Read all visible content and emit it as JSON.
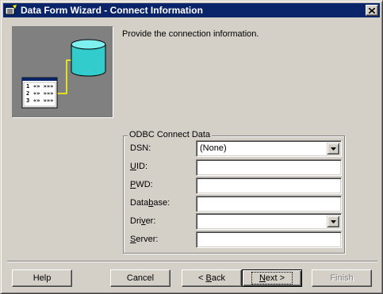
{
  "window": {
    "title": "Data Form Wizard - Connect Information",
    "close_glyph": "✕"
  },
  "prompt": "Provide the connection information.",
  "illustration": {
    "rows": [
      {
        "num": "1",
        "cells": "«» »»»"
      },
      {
        "num": "2",
        "cells": "«» »»»"
      },
      {
        "num": "3",
        "cells": "«» »»»"
      }
    ]
  },
  "group": {
    "legend": "ODBC Connect Data"
  },
  "fields": {
    "dsn": {
      "label_pre": "DSN",
      "label_u": "",
      "label_post": ":",
      "value": "(None)"
    },
    "uid": {
      "label_pre": "",
      "label_u": "U",
      "label_post": "ID:",
      "value": ""
    },
    "pwd": {
      "label_pre": "",
      "label_u": "P",
      "label_post": "WD:",
      "value": ""
    },
    "database": {
      "label_pre": "Data",
      "label_u": "b",
      "label_post": "ase:",
      "value": ""
    },
    "driver": {
      "label_pre": "Dri",
      "label_u": "v",
      "label_post": "er:",
      "value": ""
    },
    "server": {
      "label_pre": "",
      "label_u": "S",
      "label_post": "erver:",
      "value": ""
    }
  },
  "buttons": {
    "help": "Help",
    "cancel": "Cancel",
    "back_pre": "< ",
    "back_u": "B",
    "back_post": "ack",
    "next_pre": "",
    "next_u": "N",
    "next_post": "ext >",
    "finish": "Finish"
  },
  "colors": {
    "titlebar": "#0a246a",
    "face": "#d4d0c8",
    "cylinder": "#33cccc",
    "connector": "#ffff00"
  }
}
